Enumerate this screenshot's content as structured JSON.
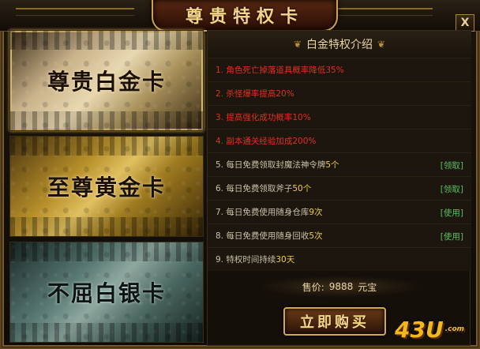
{
  "header": {
    "title": "尊贵特权卡",
    "close_label": "X"
  },
  "cards": [
    {
      "label": "尊贵白金卡"
    },
    {
      "label": "至尊黄金卡"
    },
    {
      "label": "不屈白银卡"
    }
  ],
  "panel": {
    "title": "白金特权介绍",
    "rows": [
      {
        "text": "1. 角色死亡掉落道具概率降低35%",
        "action": ""
      },
      {
        "text": "2. 杀怪爆率提高20%",
        "action": ""
      },
      {
        "text": "3. 提高强化成功概率10%",
        "action": ""
      },
      {
        "text": "4. 副本通关经验加成200%",
        "action": ""
      },
      {
        "text": "5. 每日免费领取封魔法神令牌",
        "highlight": "5个",
        "action": "[领取]"
      },
      {
        "text": "6. 每日免费领取斧子",
        "highlight": "50个",
        "action": "[领取]"
      },
      {
        "text": "7. 每日免费使用随身仓库",
        "highlight": "9次",
        "action": "[使用]"
      },
      {
        "text": "8. 每日免费使用随身回收",
        "highlight": "5次",
        "action": "[使用]"
      },
      {
        "text": "9. 特权时间持续",
        "highlight": "30天",
        "action": ""
      }
    ],
    "price_label": "售价:",
    "price_value": "9888",
    "price_unit": "元宝",
    "buy_label": "立即购买"
  },
  "logo": {
    "text": "43U",
    "suffix": ".com"
  },
  "colors": {
    "accent_gold": "#c9a24a",
    "row_red": "#e03020",
    "action_green": "#5ac060",
    "highlight_yellow": "#f0d040"
  }
}
